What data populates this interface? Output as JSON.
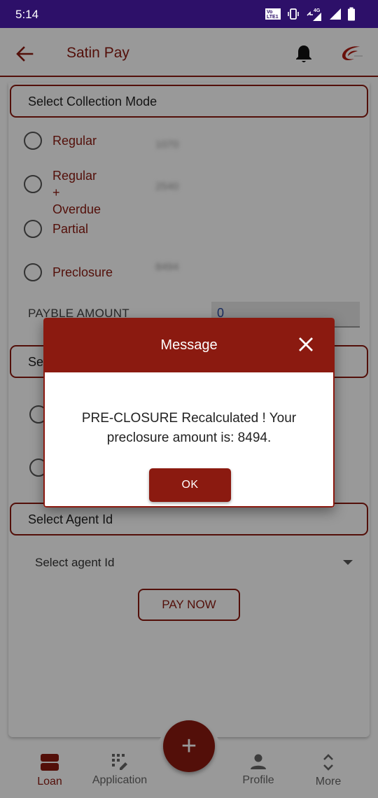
{
  "statusbar": {
    "time": "5:14",
    "icons": [
      "volte-icon",
      "vibrate-icon",
      "network-4g-icon",
      "signal-icon",
      "battery-icon"
    ]
  },
  "appbar": {
    "title": "Satin Pay",
    "back_icon": "arrow-back-icon",
    "bell_icon": "bell-icon",
    "logo_icon": "satin-logo-icon"
  },
  "form": {
    "collection_mode_label": "Select Collection Mode",
    "modes": [
      {
        "label": "Regular",
        "amount": "1070"
      },
      {
        "label": "Regular +\nOverdue",
        "amount": "2540"
      },
      {
        "label": "Partial",
        "amount": ""
      },
      {
        "label": "Preclosure",
        "amount": "8494"
      }
    ],
    "payble_label": "PAYBLE AMOUNT",
    "payble_value": "0",
    "section2_label": "Se",
    "agent_section_label": "Select Agent Id",
    "agent_select_value": "Select agent Id",
    "pay_now_label": "PAY NOW"
  },
  "dialog": {
    "title": "Message",
    "message": "PRE-CLOSURE Recalculated ! Your preclosure amount is: 8494.",
    "ok_label": "OK"
  },
  "bottomnav": {
    "items": [
      {
        "label": "Loan",
        "icon": "loan-icon",
        "active": true
      },
      {
        "label": "Application",
        "icon": "application-icon",
        "active": false
      },
      {
        "label": "Profile",
        "icon": "profile-icon",
        "active": false
      },
      {
        "label": "More",
        "icon": "more-icon",
        "active": false
      }
    ],
    "fab_icon": "plus-icon"
  },
  "colors": {
    "brand": "#8b1a10",
    "statusbar": "#2d1069"
  }
}
